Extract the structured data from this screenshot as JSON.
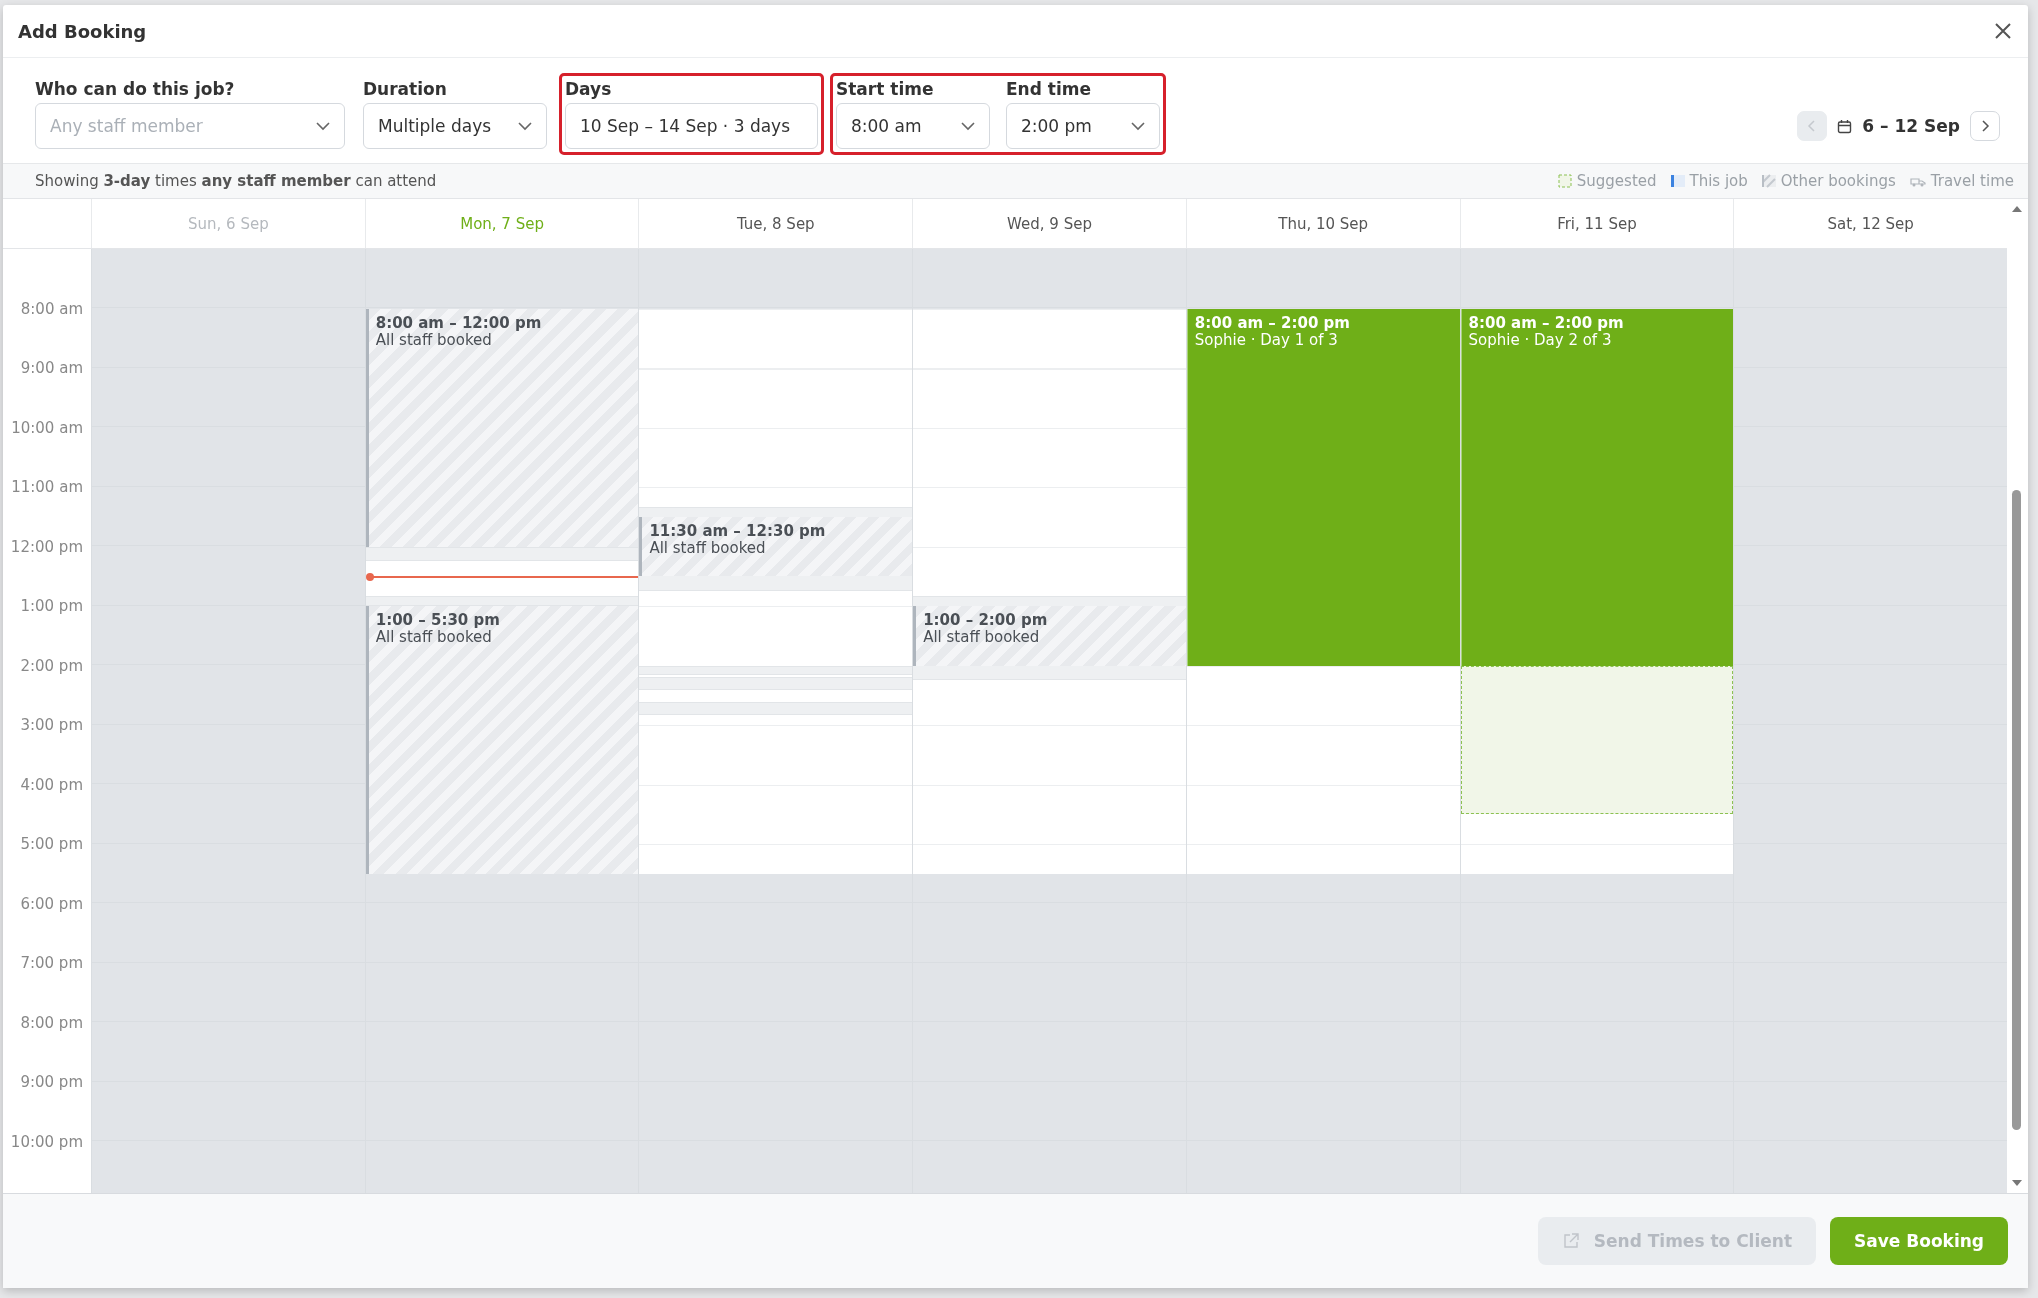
{
  "window": {
    "title": "Add Booking"
  },
  "form": {
    "groups": [
      {
        "highlighted": false,
        "fields": [
          {
            "kind": "select",
            "label": "Who can do this job?",
            "placeholder": "Any staff member"
          }
        ]
      },
      {
        "highlighted": false,
        "fields": [
          {
            "kind": "select",
            "label": "Duration",
            "value": "Multiple days"
          }
        ]
      },
      {
        "highlighted": true,
        "fields": [
          {
            "kind": "text",
            "label": "Days",
            "value": "10 Sep – 14 Sep · 3 days"
          }
        ]
      },
      {
        "highlighted": true,
        "fields": [
          {
            "kind": "select",
            "label": "Start time",
            "value": "8:00 am"
          },
          {
            "kind": "select",
            "label": "End time",
            "value": "2:00 pm"
          }
        ]
      }
    ]
  },
  "week_nav": {
    "prev_disabled": true,
    "label": "6 – 12 Sep"
  },
  "info": "Showing **3-day** times **any staff member** can attend",
  "legend": [
    {
      "kind": "suggested",
      "label": "Suggested"
    },
    {
      "kind": "job",
      "label": "This job"
    },
    {
      "kind": "other",
      "label": "Other bookings"
    },
    {
      "kind": "travel",
      "label": "Travel time"
    }
  ],
  "hours": [
    "8:00 am",
    "9:00 am",
    "10:00 am",
    "11:00 am",
    "12:00 pm",
    "1:00 pm",
    "2:00 pm",
    "3:00 pm",
    "4:00 pm",
    "5:00 pm",
    "6:00 pm",
    "7:00 pm",
    "8:00 pm",
    "9:00 pm",
    "10:00 pm"
  ],
  "days": [
    {
      "label": "Sun, 6 Sep",
      "past": true,
      "today": false,
      "open": false
    },
    {
      "label": "Mon, 7 Sep",
      "past": false,
      "today": true,
      "open": true,
      "now": true,
      "events": [
        {
          "kind": "other",
          "time": "8:00 am – 12:00 pm",
          "text": "All staff booked"
        },
        {
          "kind": "travel"
        },
        {
          "kind": "travel"
        },
        {
          "kind": "other",
          "time": "1:00 – 5:30 pm",
          "text": "All staff booked"
        }
      ]
    },
    {
      "label": "Tue, 8 Sep",
      "past": false,
      "today": false,
      "open": true,
      "events": [
        {
          "kind": "travel"
        },
        {
          "kind": "other",
          "time": "11:30 am – 12:30 pm",
          "text": "All staff booked"
        },
        {
          "kind": "travel"
        },
        {
          "kind": "travel"
        },
        {
          "kind": "travel"
        }
      ]
    },
    {
      "label": "Wed, 9 Sep",
      "past": false,
      "today": false,
      "open": true,
      "events": [
        {
          "kind": "travel"
        },
        {
          "kind": "other",
          "time": "1:00 – 2:00 pm",
          "text": "All staff booked"
        }
      ]
    },
    {
      "label": "Thu, 10 Sep",
      "past": false,
      "today": false,
      "open": true,
      "events": [
        {
          "kind": "job",
          "time": "8:00 am – 2:00 pm",
          "text": "Sophie · Day 1 of 3"
        }
      ]
    },
    {
      "label": "Fri, 11 Sep",
      "past": false,
      "today": false,
      "open": true,
      "events": [
        {
          "kind": "job",
          "time": "8:00 am – 2:00 pm",
          "text": "Sophie · Day 2 of 3"
        },
        {
          "kind": "suggested"
        }
      ]
    },
    {
      "label": "Sat, 12 Sep",
      "past": false,
      "today": false,
      "open": false
    }
  ],
  "buttons": [
    {
      "kind": "secondary",
      "label": "Send Times to Client",
      "disabled": true
    },
    {
      "kind": "primary",
      "label": "Save Booking",
      "disabled": false
    }
  ]
}
